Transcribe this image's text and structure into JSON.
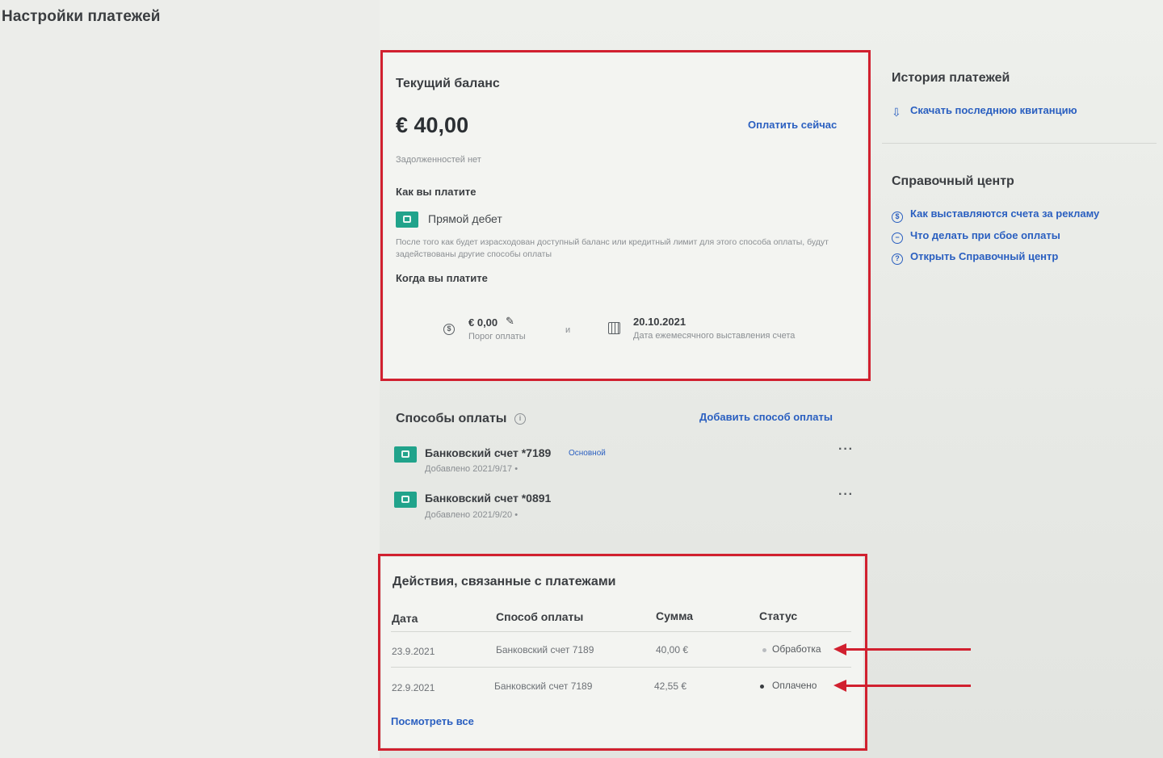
{
  "page": {
    "title": "Настройки платежей"
  },
  "balance": {
    "title": "Текущий баланс",
    "amount": "€ 40,00",
    "pay_now": "Оплатить сейчас",
    "debt_note": "Задолженностей нет",
    "how_you_pay_label": "Как вы платите",
    "method_name": "Прямой дебет",
    "method_note": "После того как будет израсходован доступный баланс или кредитный лимит для этого способа оплаты, будут задействованы другие способы оплаты",
    "when_you_pay_label": "Когда вы платите",
    "threshold_value": "€ 0,00",
    "threshold_label": "Порог оплаты",
    "joiner": "и",
    "billing_date_value": "20.10.2021",
    "billing_date_label": "Дата ежемесячного выставления счета"
  },
  "methods": {
    "title": "Способы оплаты",
    "add_link": "Добавить способ оплаты",
    "items": [
      {
        "name": "Банковский счет *7189",
        "badge": "Основной",
        "added": "Добавлено 2021/9/17 •"
      },
      {
        "name": "Банковский счет *0891",
        "badge": "",
        "added": "Добавлено 2021/9/20 •"
      }
    ]
  },
  "activity": {
    "title": "Действия, связанные с платежами",
    "columns": [
      "Дата",
      "Способ оплаты",
      "Сумма",
      "Статус"
    ],
    "rows": [
      {
        "date": "23.9.2021",
        "method": "Банковский счет 7189",
        "amount": "40,00 €",
        "status": "Обработка"
      },
      {
        "date": "22.9.2021",
        "method": "Банковский счет 7189",
        "amount": "42,55 €",
        "status": "Оплачено"
      }
    ],
    "view_all": "Посмотреть все"
  },
  "sidebar": {
    "history_title": "История платежей",
    "download_receipt": "Скачать последнюю квитанцию",
    "help_title": "Справочный центр",
    "help_links": [
      "Как выставляются счета за рекламу",
      "Что делать при сбое оплаты",
      "Открыть Справочный центр"
    ]
  },
  "colors": {
    "highlight_frame": "#d1202f",
    "link": "#2a5fc0",
    "bank_icon": "#21a38b"
  }
}
